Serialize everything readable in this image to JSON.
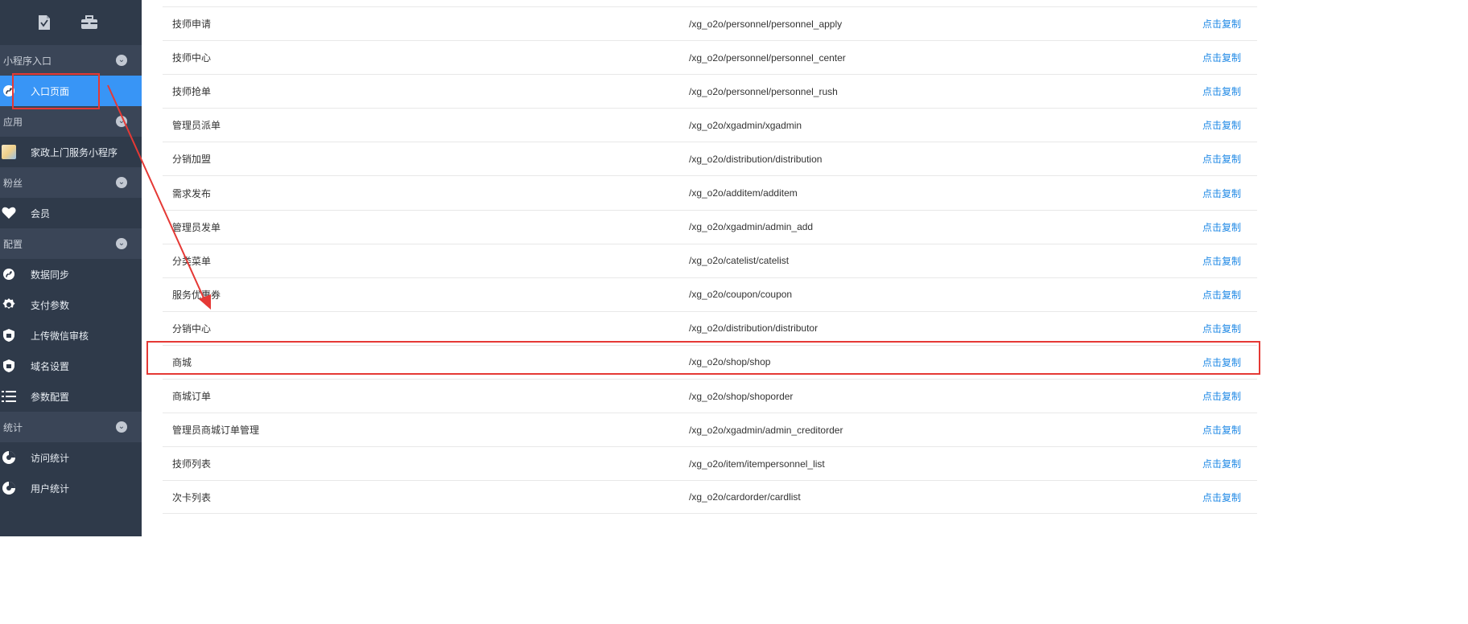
{
  "sidebar": {
    "top_icons": [
      {
        "icon": "document-check-icon"
      },
      {
        "icon": "briefcase-icon"
      }
    ],
    "sections": [
      {
        "title": "小程序入口",
        "items": [
          {
            "label": "入口页面",
            "icon": "link-icon",
            "active": true
          }
        ]
      },
      {
        "title": "应用",
        "items": [
          {
            "label": "家政上门服务小程序",
            "icon": "app-thumbnail-icon",
            "active": false
          }
        ]
      },
      {
        "title": "粉丝",
        "items": [
          {
            "label": "会员",
            "icon": "heart-icon",
            "active": false
          }
        ]
      },
      {
        "title": "配置",
        "items": [
          {
            "label": "数据同步",
            "icon": "link-icon",
            "active": false
          },
          {
            "label": "支付参数",
            "icon": "gear-icon",
            "active": false
          },
          {
            "label": "上传微信审核",
            "icon": "shield-icon",
            "active": false
          },
          {
            "label": "域名设置",
            "icon": "shield-icon",
            "active": false
          },
          {
            "label": "参数配置",
            "icon": "list-icon",
            "active": false
          }
        ]
      },
      {
        "title": "统计",
        "items": [
          {
            "label": "访问统计",
            "icon": "chart-circle-icon",
            "active": false
          },
          {
            "label": "用户统计",
            "icon": "chart-circle-icon",
            "active": false
          }
        ]
      }
    ]
  },
  "table": {
    "rows": [
      {
        "name": "技师申请",
        "path": "/xg_o2o/personnel/personnel_apply",
        "action": "点击复制"
      },
      {
        "name": "技师中心",
        "path": "/xg_o2o/personnel/personnel_center",
        "action": "点击复制"
      },
      {
        "name": "技师抢单",
        "path": "/xg_o2o/personnel/personnel_rush",
        "action": "点击复制"
      },
      {
        "name": "管理员派单",
        "path": "/xg_o2o/xgadmin/xgadmin",
        "action": "点击复制"
      },
      {
        "name": "分销加盟",
        "path": "/xg_o2o/distribution/distribution",
        "action": "点击复制"
      },
      {
        "name": "需求发布",
        "path": "/xg_o2o/additem/additem",
        "action": "点击复制"
      },
      {
        "name": "管理员发单",
        "path": "/xg_o2o/xgadmin/admin_add",
        "action": "点击复制"
      },
      {
        "name": "分类菜单",
        "path": "/xg_o2o/catelist/catelist",
        "action": "点击复制"
      },
      {
        "name": "服务优惠券",
        "path": "/xg_o2o/coupon/coupon",
        "action": "点击复制"
      },
      {
        "name": "分销中心",
        "path": "/xg_o2o/distribution/distributor",
        "action": "点击复制"
      },
      {
        "name": "商城",
        "path": "/xg_o2o/shop/shop",
        "action": "点击复制"
      },
      {
        "name": "商城订单",
        "path": "/xg_o2o/shop/shoporder",
        "action": "点击复制"
      },
      {
        "name": "管理员商城订单管理",
        "path": "/xg_o2o/xgadmin/admin_creditorder",
        "action": "点击复制"
      },
      {
        "name": "技师列表",
        "path": "/xg_o2o/item/itempersonnel_list",
        "action": "点击复制"
      },
      {
        "name": "次卡列表",
        "path": "/xg_o2o/cardorder/cardlist",
        "action": "点击复制"
      }
    ]
  },
  "colors": {
    "sidebar_bg": "#2f3a4a",
    "section_bg": "#3a4557",
    "active_bg": "#3895f6",
    "link": "#1e88e5",
    "annotation": "#e53935"
  }
}
